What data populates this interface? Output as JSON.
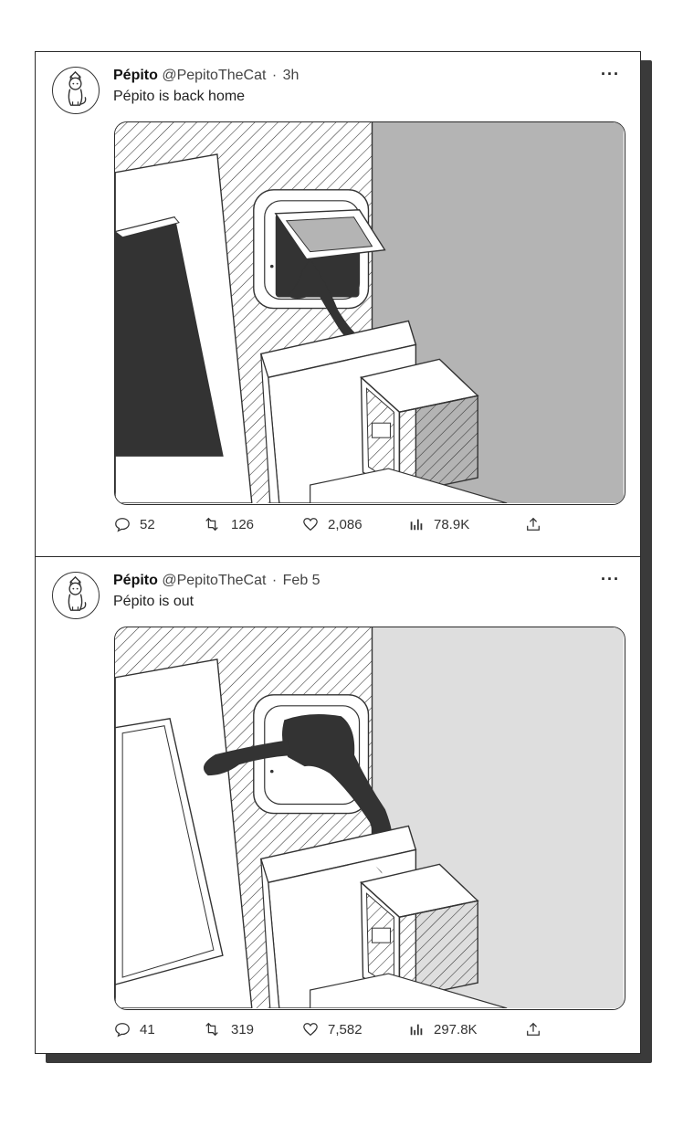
{
  "tweets": [
    {
      "name": "Pépito",
      "handle": "@PepitoTheCat",
      "separator": "·",
      "time": "3h",
      "more": "···",
      "text": "Pépito is back home",
      "replies": "52",
      "retweets": "126",
      "likes": "2,086",
      "views": "78.9K",
      "photo": {
        "wall_color": "#b4b4b4",
        "cat_pose": "back-home"
      }
    },
    {
      "name": "Pépito",
      "handle": "@PepitoTheCat",
      "separator": "·",
      "time": "Feb 5",
      "more": "···",
      "text": "Pépito is out",
      "replies": "41",
      "retweets": "319",
      "likes": "7,582",
      "views": "297.8K",
      "photo": {
        "wall_color": "#dedede",
        "cat_pose": "going-out"
      }
    }
  ],
  "icons": {
    "avatar": "cat-avatar-icon",
    "more": "more-icon",
    "reply": "reply-icon",
    "retweet": "retweet-icon",
    "like": "heart-icon",
    "views": "views-icon",
    "share": "share-icon"
  },
  "colors": {
    "ink": "#2a2a2a",
    "shadow": "#3a3a3a"
  }
}
